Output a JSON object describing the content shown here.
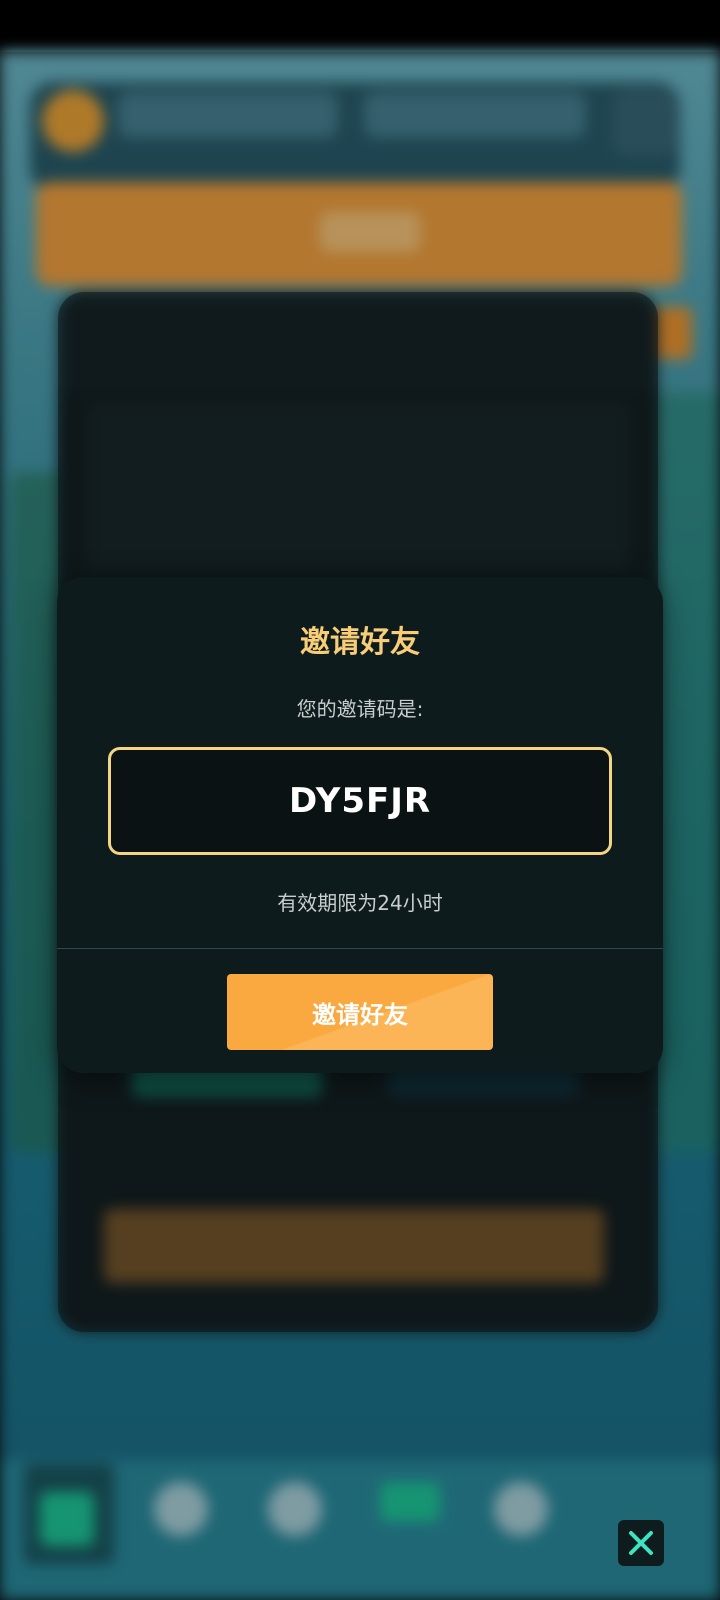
{
  "invite_modal": {
    "title": "邀请好友",
    "subtitle": "您的邀请码是:",
    "code": "DY5FJR",
    "validity_note": "有效期限为24小时",
    "invite_button_label": "邀请好友"
  },
  "bottom_nav": {
    "icons": [
      "triangle-icon",
      "gift-icon",
      "compass-icon",
      "diamond-icon",
      "heart-icon"
    ]
  },
  "colors": {
    "modal_bg": "#0e1b1c",
    "title": "#f7cd78",
    "code_border": "#f4d585",
    "button": "#f9a940"
  }
}
